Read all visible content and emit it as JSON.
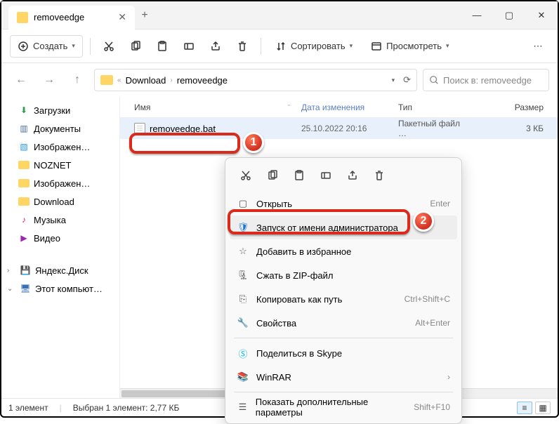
{
  "window": {
    "title": "removeedge"
  },
  "toolbar": {
    "create": "Создать",
    "sort": "Сортировать",
    "view": "Просмотреть"
  },
  "breadcrumb": {
    "parts": [
      "Download",
      "removeedge"
    ]
  },
  "search": {
    "placeholder": "Поиск в: removeedge"
  },
  "sidebar": {
    "items": [
      {
        "label": "Загрузки",
        "color": "#2e9b4f",
        "glyph": "⬇"
      },
      {
        "label": "Документы",
        "color": "#4a6fa5",
        "glyph": "📄"
      },
      {
        "label": "Изображен…",
        "color": "#2196f3",
        "glyph": "🖼"
      },
      {
        "label": "NOZNET",
        "folder": true
      },
      {
        "label": "Изображен…",
        "folder": true
      },
      {
        "label": "Download",
        "folder": true
      },
      {
        "label": "Музыка",
        "color": "#e91e63",
        "glyph": "🎵"
      },
      {
        "label": "Видео",
        "color": "#9c27b0",
        "glyph": "🎬"
      }
    ],
    "bottom": [
      {
        "label": "Яндекс.Диск",
        "chev": "›",
        "glyph": "💾"
      },
      {
        "label": "Этот компьют…",
        "chev": "⌄",
        "glyph": "🖥"
      }
    ]
  },
  "columns": {
    "name": "Имя",
    "date": "Дата изменения",
    "type": "Тип",
    "size": "Размер"
  },
  "file": {
    "name": "removeedge.bat",
    "date": "25.10.2022 20:16",
    "type": "Пакетный файл …",
    "size": "3 КБ"
  },
  "status": {
    "count": "1 элемент",
    "selected": "Выбран 1 элемент: 2,77 КБ"
  },
  "ctx": {
    "open": "Открыть",
    "open_key": "Enter",
    "runas": "Запуск от имени администратора",
    "fav": "Добавить в избранное",
    "zip": "Сжать в ZIP-файл",
    "copypath": "Копировать как путь",
    "copypath_key": "Ctrl+Shift+C",
    "props": "Свойства",
    "props_key": "Alt+Enter",
    "skype": "Поделиться в Skype",
    "winrar": "WinRAR",
    "more": "Показать дополнительные параметры",
    "more_key": "Shift+F10"
  },
  "badges": {
    "one": "1",
    "two": "2"
  }
}
